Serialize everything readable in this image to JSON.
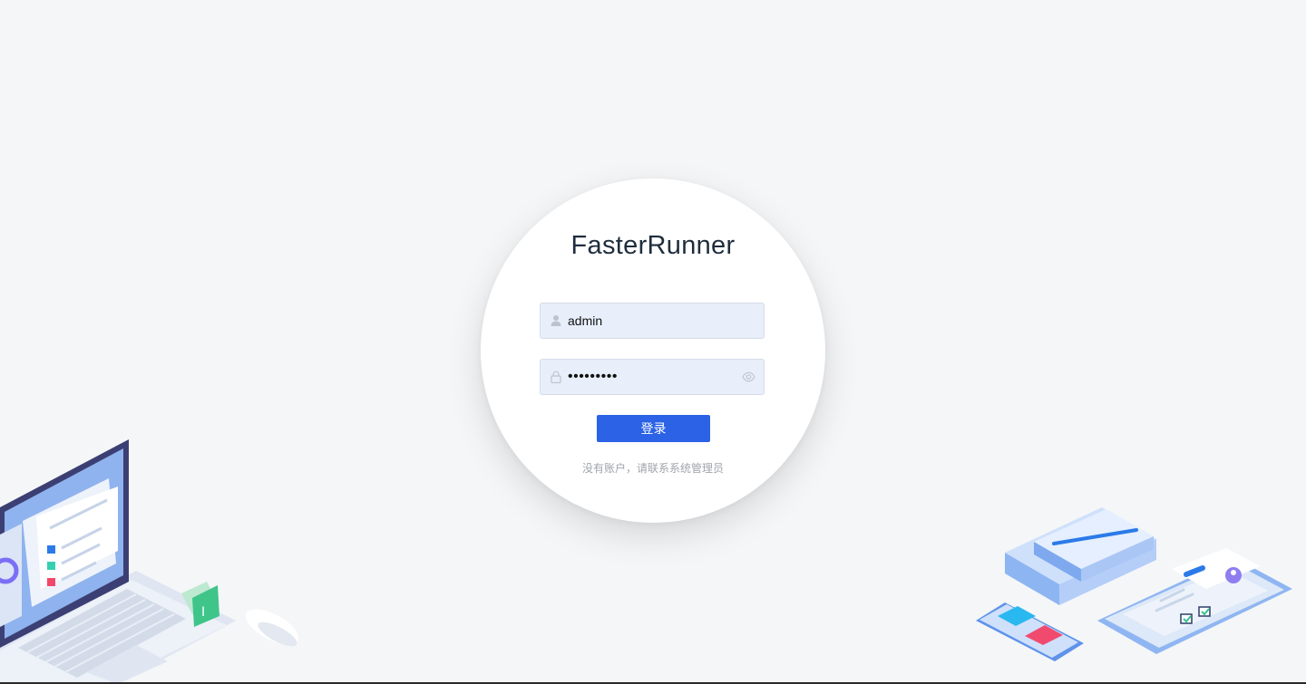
{
  "app": {
    "title": "FasterRunner"
  },
  "login": {
    "username_value": "admin",
    "password_value": "•••••••••",
    "submit_label": "登录",
    "hint_text": "没有账户，请联系系统管理员"
  },
  "icons": {
    "username_prefix": "user-icon",
    "password_prefix": "lock-icon",
    "password_suffix": "eye-icon"
  },
  "colors": {
    "background": "#f5f6f8",
    "primary_button": "#2b62e6",
    "input_background": "#e8effb",
    "title_text": "#1f2d3d",
    "hint_text": "#a0a4ab"
  }
}
